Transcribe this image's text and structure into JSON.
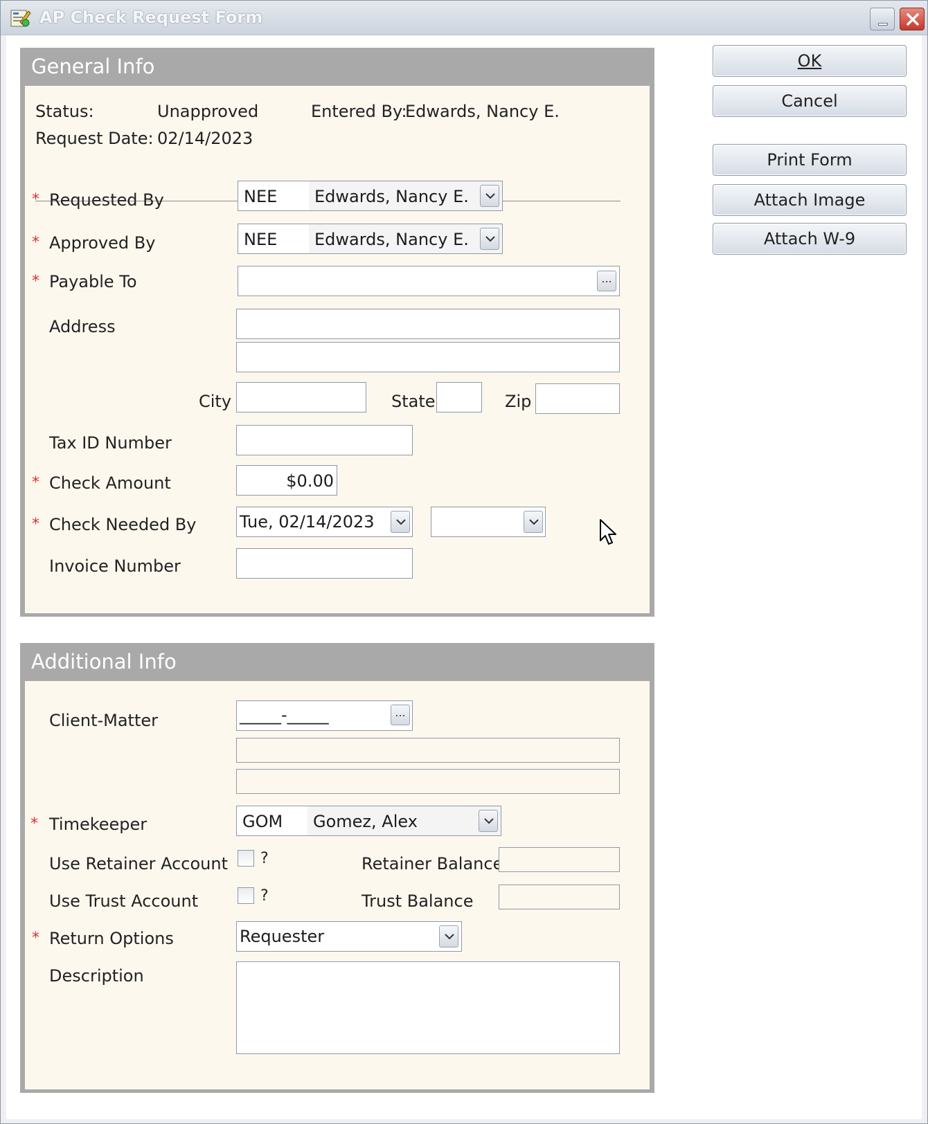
{
  "window": {
    "title": "AP Check Request Form",
    "minimize_label": "_",
    "close_label": "X"
  },
  "buttons": {
    "ok": "OK",
    "cancel": "Cancel",
    "print_form": "Print Form",
    "attach_image": "Attach Image",
    "attach_w9": "Attach W-9"
  },
  "general": {
    "header": "General Info",
    "status_label": "Status:",
    "status_value": "Unapproved",
    "entered_by_label": "Entered By:",
    "entered_by_value": "Edwards, Nancy E.",
    "request_date_label": "Request Date:",
    "request_date_value": "02/14/2023",
    "requested_by": {
      "label": "Requested By",
      "code": "NEE",
      "name": "Edwards, Nancy E."
    },
    "approved_by": {
      "label": "Approved By",
      "code": "NEE",
      "name": "Edwards, Nancy E."
    },
    "payable_to": {
      "label": "Payable To",
      "value": ""
    },
    "address": {
      "label": "Address",
      "line1": "",
      "line2": ""
    },
    "city": {
      "label": "City",
      "value": ""
    },
    "state": {
      "label": "State",
      "value": ""
    },
    "zip": {
      "label": "Zip",
      "value": ""
    },
    "tax_id": {
      "label": "Tax ID Number",
      "value": ""
    },
    "check_amount": {
      "label": "Check Amount",
      "value": "$0.00"
    },
    "check_needed_by": {
      "label": "Check Needed By",
      "date": "Tue, 02/14/2023",
      "second": ""
    },
    "invoice_number": {
      "label": "Invoice Number",
      "value": ""
    }
  },
  "additional": {
    "header": "Additional Info",
    "client_matter": {
      "label": "Client-Matter",
      "value": "_____-_____",
      "line2": "",
      "line3": ""
    },
    "timekeeper": {
      "label": "Timekeeper",
      "code": "GOM",
      "name": "Gomez, Alex"
    },
    "use_retainer": {
      "label": "Use Retainer Account",
      "checked": false,
      "help": "?"
    },
    "retainer_balance": {
      "label": "Retainer Balance",
      "value": ""
    },
    "use_trust": {
      "label": "Use Trust Account",
      "checked": false,
      "help": "?"
    },
    "trust_balance": {
      "label": "Trust Balance",
      "value": ""
    },
    "return_options": {
      "label": "Return Options",
      "value": "Requester"
    },
    "description": {
      "label": "Description",
      "value": ""
    }
  },
  "required_marker": "*",
  "ellipsis": "...",
  "icons": [
    "app-icon",
    "dropdown-arrow-icon",
    "ellipsis-icon",
    "close-icon",
    "minimize-icon",
    "mouse-cursor-icon"
  ]
}
